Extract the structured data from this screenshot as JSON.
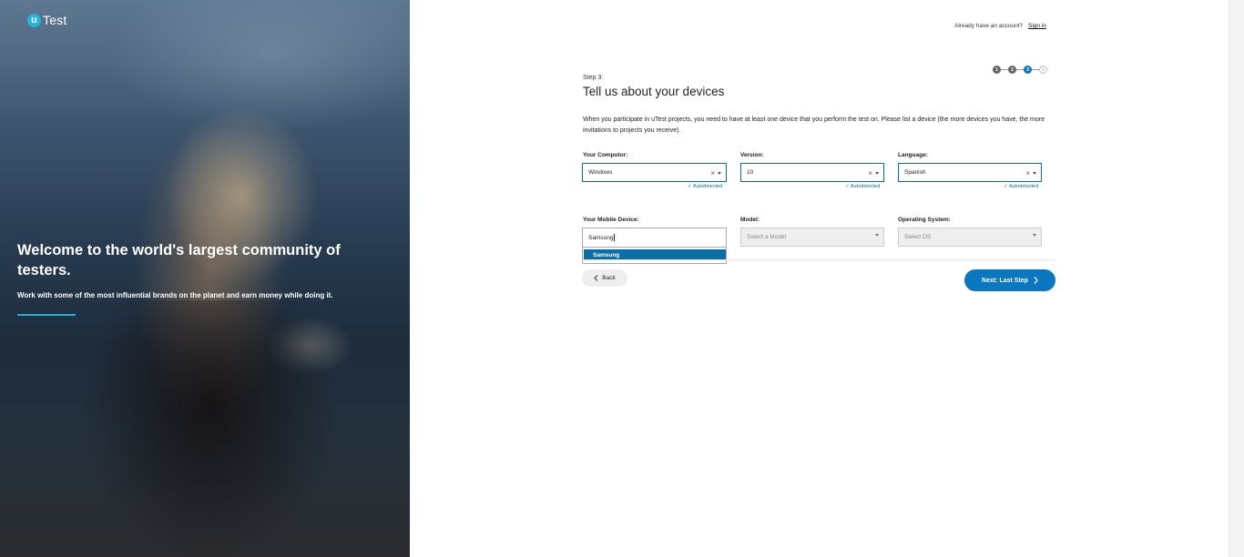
{
  "logo": {
    "letter": "u",
    "text": "Test"
  },
  "hero": {
    "title": "Welcome to the world's largest community of testers.",
    "subtitle": "Work with some of the most influential brands on the planet and earn money while doing it."
  },
  "header": {
    "account_text": "Already have an account?",
    "signin_label": "Sign in"
  },
  "stepper": {
    "steps": [
      "1",
      "2",
      "3",
      "4"
    ],
    "current": 3
  },
  "form": {
    "step_label": "Step 3:",
    "title": "Tell us about your devices",
    "intro": "When you participate in uTest projects, you need to have at least one device that you perform the test on. Please list a device (the more devices you have, the more invitations to projects you receive).",
    "computer": {
      "label": "Your Computor:",
      "value": "Windows",
      "autodetect": "✓ Autodetected"
    },
    "version": {
      "label": "Version:",
      "value": "10",
      "autodetect": "✓ Autodetected"
    },
    "language": {
      "label": "Language:",
      "value": "Spanish",
      "autodetect": "✓ Autodetected"
    },
    "mobile": {
      "label": "Your Mobile Device:",
      "value": "Samsung",
      "option": "Samsung"
    },
    "model": {
      "label": "Model:",
      "placeholder": "Select a Model"
    },
    "os": {
      "label": "Operating System:",
      "placeholder": "Select OS"
    }
  },
  "buttons": {
    "back": "Back",
    "next": "Next: Last Step"
  },
  "colors": {
    "accent": "#0a77c0",
    "brand": "#26b6d8"
  }
}
